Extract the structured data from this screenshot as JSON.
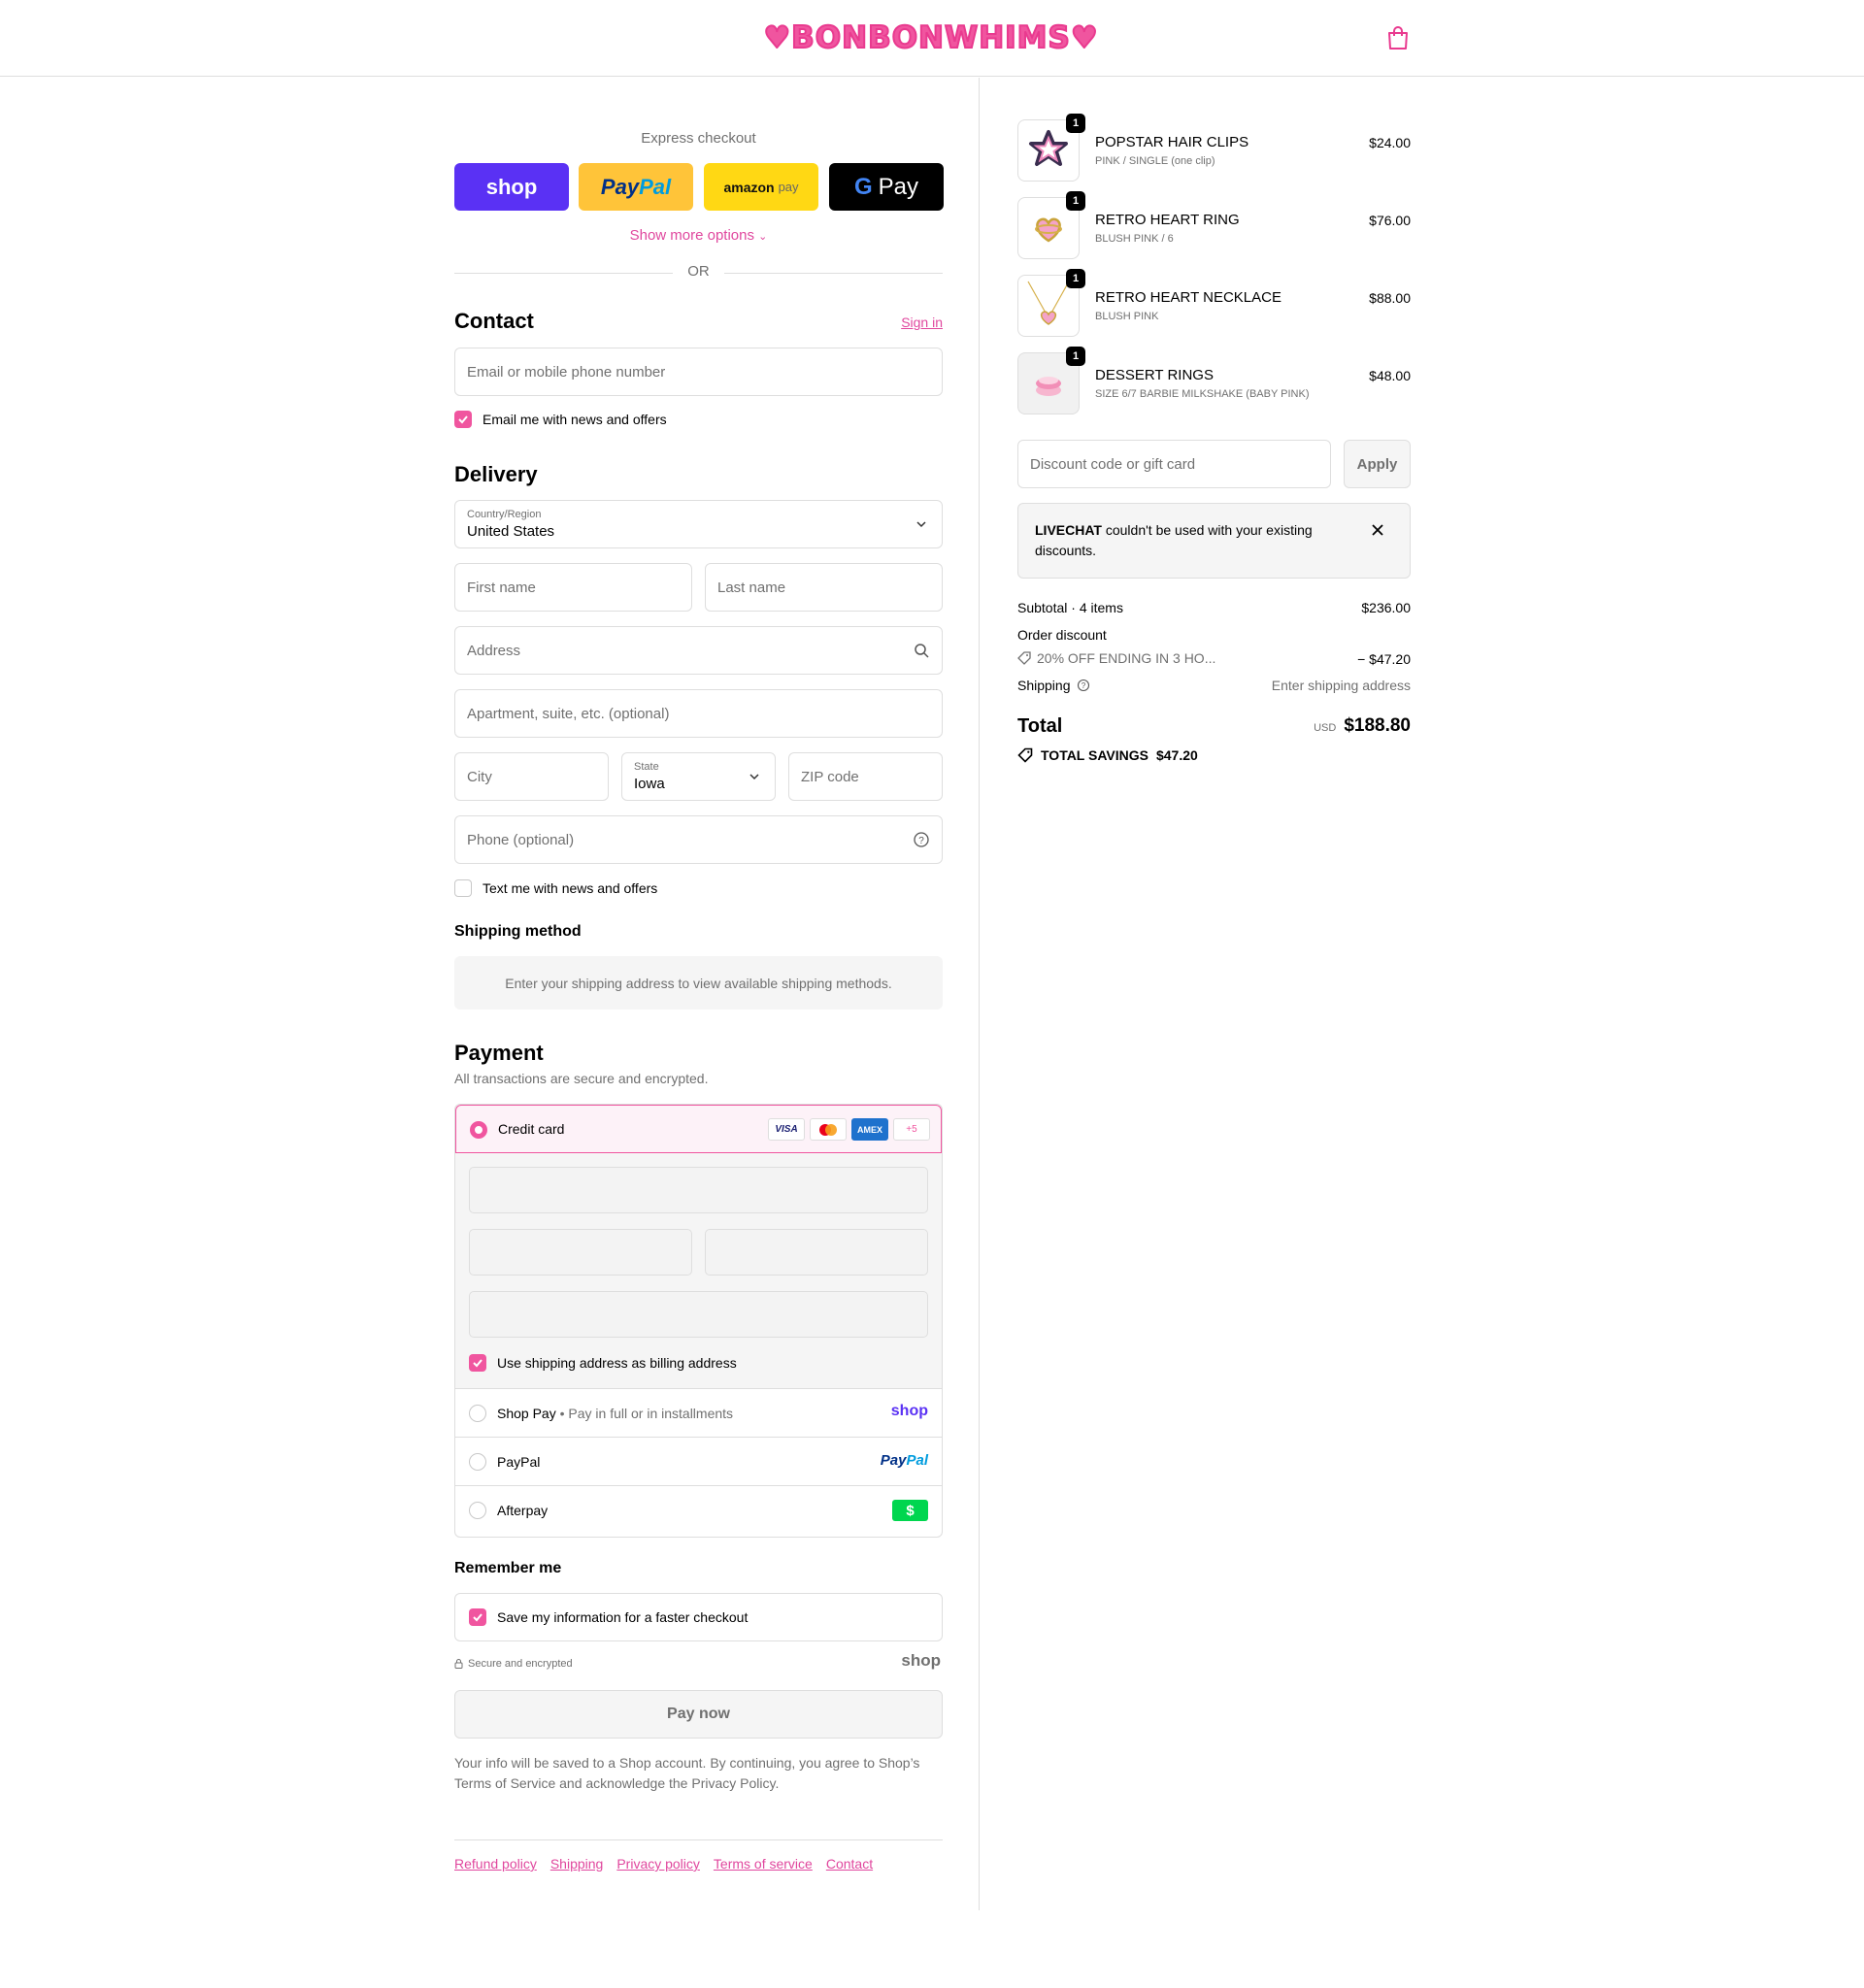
{
  "header": {
    "logo_text": "♥BONBONWHIMS♥",
    "cart_icon": "shopping-bag-icon"
  },
  "express": {
    "title": "Express checkout",
    "shop_label": "shop",
    "paypal_label_1": "Pay",
    "paypal_label_2": "Pal",
    "amazon_label": "amazon",
    "amazon_pay": "pay",
    "gpay_g": "G",
    "gpay_label": "Pay",
    "more_options": "Show more options",
    "or": "OR"
  },
  "contact": {
    "heading": "Contact",
    "sign_in": "Sign in",
    "email_placeholder": "Email or mobile phone number",
    "email_news_label": "Email me with news and offers",
    "email_news_checked": true
  },
  "delivery": {
    "heading": "Delivery",
    "country_label": "Country/Region",
    "country_value": "United States",
    "first_name_placeholder": "First name",
    "last_name_placeholder": "Last name",
    "address_placeholder": "Address",
    "apartment_placeholder": "Apartment, suite, etc. (optional)",
    "city_placeholder": "City",
    "state_label": "State",
    "state_value": "Iowa",
    "zip_placeholder": "ZIP code",
    "phone_placeholder": "Phone (optional)",
    "text_news_label": "Text me with news and offers",
    "text_news_checked": false
  },
  "shipping_method": {
    "heading": "Shipping method",
    "message": "Enter your shipping address to view available shipping methods."
  },
  "payment": {
    "heading": "Payment",
    "subtitle": "All transactions are secure and encrypted.",
    "credit_card_label": "Credit card",
    "card_logos": [
      "VISA",
      "",
      "AMEX",
      "+5"
    ],
    "billing_label": "Use shipping address as billing address",
    "billing_checked": true,
    "shop_pay_label": "Shop Pay",
    "shop_pay_sep": "•",
    "shop_pay_sub": "Pay in full or in installments",
    "shop_pay_logo": "shop",
    "paypal_label": "PayPal",
    "paypal_logo_1": "Pay",
    "paypal_logo_2": "Pal",
    "afterpay_label": "Afterpay",
    "afterpay_logo": "$"
  },
  "remember": {
    "heading": "Remember me",
    "save_label": "Save my information for a faster checkout",
    "save_checked": true,
    "secure_label": "Secure and encrypted",
    "shop_logo": "shop"
  },
  "pay_now": "Pay now",
  "legal": {
    "text_1": "Your info will be saved to a Shop account. By continuing, you agree to Shop’s",
    "terms": "Terms of Service",
    "text_2": "and acknowledge the",
    "privacy": "Privacy Policy",
    "text_3": "."
  },
  "footer_links": [
    "Refund policy",
    "Shipping",
    "Privacy policy",
    "Terms of service",
    "Contact"
  ],
  "cart": {
    "items": [
      {
        "qty": "1",
        "title": "POPSTAR HAIR CLIPS",
        "variant": "PINK / SINGLE (one clip)",
        "price": "$24.00"
      },
      {
        "qty": "1",
        "title": "RETRO HEART RING",
        "variant": "BLUSH PINK / 6",
        "price": "$76.00"
      },
      {
        "qty": "1",
        "title": "RETRO HEART NECKLACE",
        "variant": "BLUSH PINK",
        "price": "$88.00"
      },
      {
        "qty": "1",
        "title": "DESSERT RINGS",
        "variant": "SIZE 6/7 BARBIE MILKSHAKE (BABY PINK)",
        "price": "$48.00"
      }
    ],
    "discount_placeholder": "Discount code or gift card",
    "apply": "Apply",
    "notice_code": "LIVECHAT",
    "notice_text": "couldn't be used with your existing discounts.",
    "subtotal_label": "Subtotal · 4 items",
    "subtotal_value": "$236.00",
    "order_discount_label": "Order discount",
    "discount_code": "20% OFF ENDING IN 3 HO...",
    "discount_value": "− $47.20",
    "shipping_label": "Shipping",
    "shipping_value": "Enter shipping address",
    "total_label": "Total",
    "currency": "USD",
    "total_value": "$188.80",
    "savings_label": "TOTAL SAVINGS",
    "savings_value": "$47.20"
  },
  "colors": {
    "accent": "#f0559f",
    "link": "#e0479e",
    "shop_purple": "#5a31f4",
    "paypal_yellow": "#ffc439",
    "amazon_yellow": "#ffd814"
  }
}
